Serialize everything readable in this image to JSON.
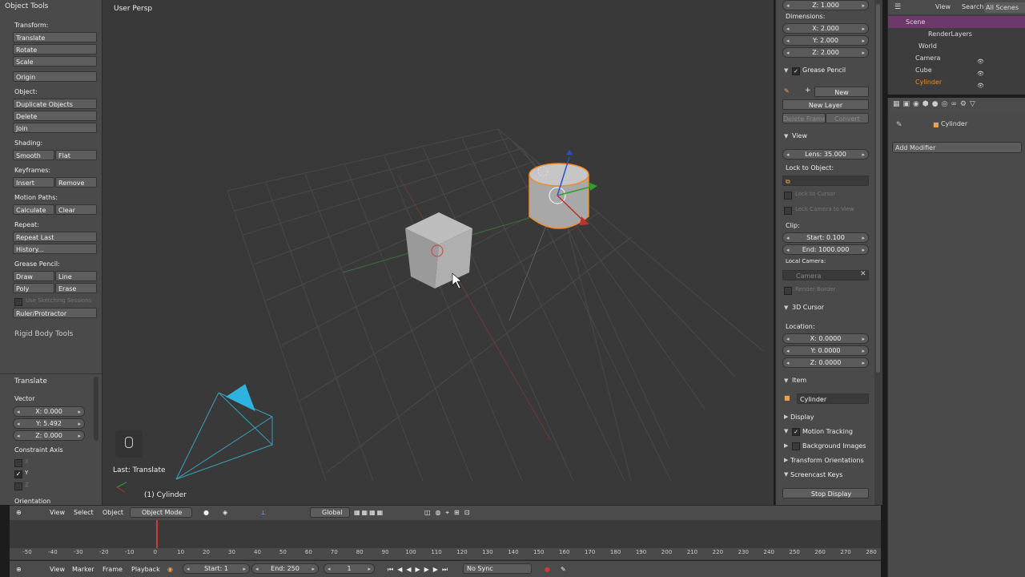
{
  "toolshelf": {
    "object_tools_title": "Object Tools",
    "transform_label": "Transform:",
    "translate": "Translate",
    "rotate": "Rotate",
    "scale": "Scale",
    "origin": "Origin",
    "object_label": "Object:",
    "duplicate": "Duplicate Objects",
    "delete": "Delete",
    "join": "Join",
    "shading_label": "Shading:",
    "smooth": "Smooth",
    "flat": "Flat",
    "keyframes_label": "Keyframes:",
    "insert": "Insert",
    "remove": "Remove",
    "motion_label": "Motion Paths:",
    "calculate": "Calculate",
    "clear": "Clear",
    "repeat_label": "Repeat:",
    "repeat_last": "Repeat Last",
    "history": "History...",
    "gp_label": "Grease Pencil:",
    "draw": "Draw",
    "line": "Line",
    "poly": "Poly",
    "erase": "Erase",
    "use_sketching": "Use Sketching Sessions",
    "ruler": "Ruler/Protractor",
    "rigid_body": "Rigid Body Tools"
  },
  "operator": {
    "title": "Translate",
    "vector_label": "Vector",
    "x": "X: 0.000",
    "y": "Y: 5.492",
    "z": "Z: 0.000",
    "constraint_label": "Constraint Axis",
    "ax_x": "X",
    "ax_y": "Y",
    "ax_z": "Z",
    "orientation_label": "Orientation"
  },
  "viewport": {
    "view_name": "User Persp",
    "last_op": "Last: Translate",
    "active_obj": "(1) Cylinder"
  },
  "nprops": {
    "top_z": "Z: 1.000",
    "dimensions_label": "Dimensions:",
    "dim_x": "X: 2.000",
    "dim_y": "Y: 2.000",
    "dim_z": "Z: 2.000",
    "grease_pencil": "Grease Pencil",
    "new": "New",
    "new_layer": "New Layer",
    "delete_frame": "Delete Frame",
    "convert": "Convert",
    "view_title": "View",
    "lens": "Lens: 35.000",
    "lock_to_object": "Lock to Object:",
    "lock_to_cursor": "Lock to Cursor",
    "lock_camera": "Lock Camera to View",
    "clip_label": "Clip:",
    "clip_start": "Start: 0.100",
    "clip_end": "End: 1000.000",
    "local_camera": "Local Camera:",
    "camera_field": "Camera",
    "render_border": "Render Border",
    "cursor_title": "3D Cursor",
    "location_label": "Location:",
    "loc_x": "X: 0.0000",
    "loc_y": "Y: 0.0000",
    "loc_z": "Z: 0.0000",
    "item_title": "Item",
    "item_name": "Cylinder",
    "display_title": "Display",
    "motion_tracking": "Motion Tracking",
    "background_images": "Background Images",
    "transform_orientations": "Transform Orientations",
    "screencast_keys": "Screencast Keys",
    "stop_display": "Stop Display"
  },
  "outliner": {
    "view": "View",
    "search": "Search",
    "scenes": "All Scenes",
    "rows": [
      "Scene",
      "RenderLayers",
      "World",
      "Camera",
      "Cube",
      "Cylinder"
    ]
  },
  "properties": {
    "object_name": "Cylinder",
    "add_modifier": "Add Modifier"
  },
  "view_header": {
    "view": "View",
    "select": "Select",
    "object": "Object",
    "mode": "Object Mode",
    "orientation": "Global"
  },
  "timeline": {
    "ticks": [
      "-50",
      "-40",
      "-30",
      "-20",
      "-10",
      "0",
      "10",
      "20",
      "30",
      "40",
      "50",
      "60",
      "70",
      "80",
      "90",
      "100",
      "110",
      "120",
      "130",
      "140",
      "150",
      "160",
      "170",
      "180",
      "190",
      "200",
      "210",
      "220",
      "230",
      "240",
      "250",
      "260",
      "270",
      "280"
    ],
    "view": "View",
    "marker": "Marker",
    "frame": "Frame",
    "playback": "Playback",
    "start": "Start: 1",
    "end": "End: 250",
    "current": "1",
    "sync": "No Sync"
  },
  "colors": {
    "selected": "#f08a2a",
    "accent": "#ff9a3a",
    "red_frame": "#d03a3a"
  }
}
